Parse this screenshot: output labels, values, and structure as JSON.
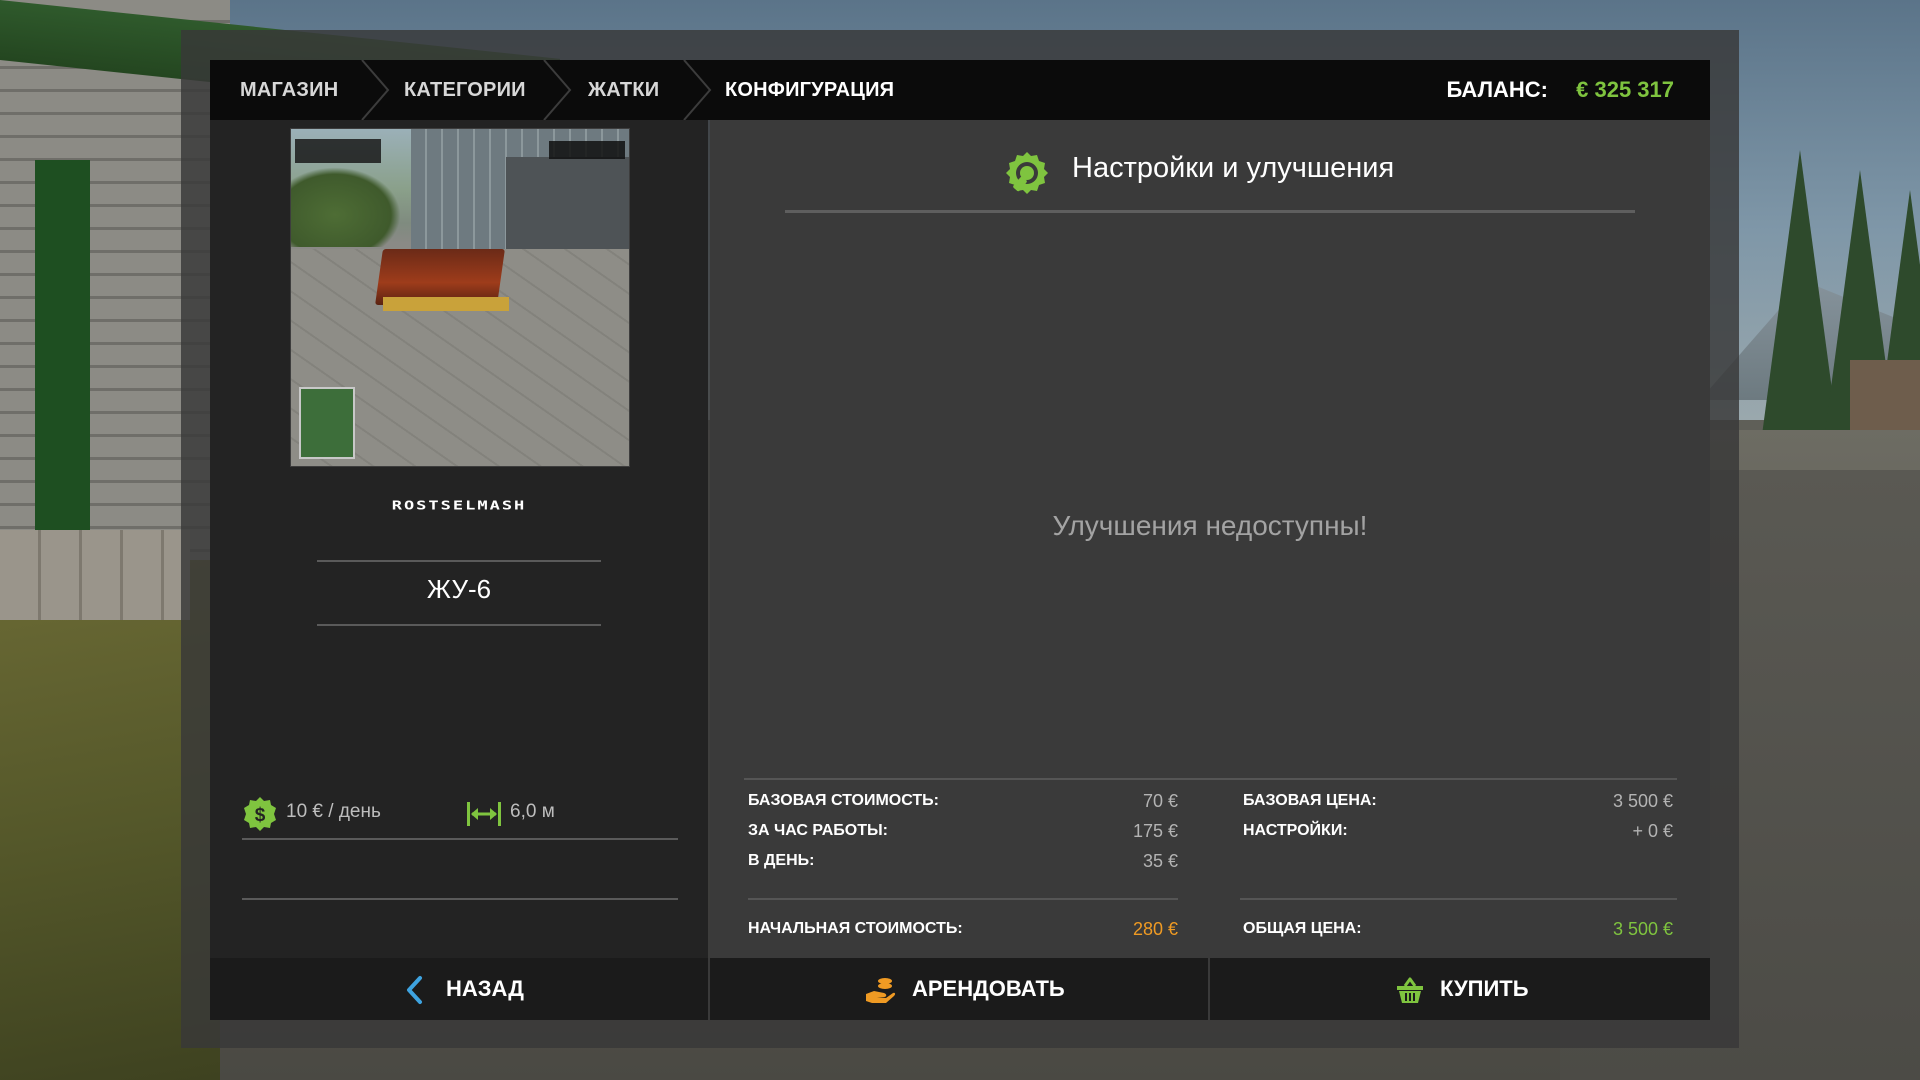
{
  "breadcrumb": {
    "items": [
      "МАГАЗИН",
      "КАТЕГОРИИ",
      "ЖАТКИ",
      "КОНФИГУРАЦИЯ"
    ]
  },
  "balance": {
    "label": "БАЛАНС:",
    "value": "€ 325 317"
  },
  "vehicle": {
    "brand": "ROSTSELMASH",
    "model": "ЖУ-6",
    "stats": {
      "rent_per_day": "10 € / день",
      "width": "6,0 м"
    }
  },
  "config": {
    "title": "Настройки и улучшения",
    "empty_message": "Улучшения недоступны!"
  },
  "costs": {
    "left": [
      {
        "label": "БАЗОВАЯ СТОИМОСТЬ:",
        "value": "70 €"
      },
      {
        "label": "ЗА ЧАС РАБОТЫ:",
        "value": "175 €"
      },
      {
        "label": "В ДЕНЬ:",
        "value": "35 €"
      }
    ],
    "left_total": {
      "label": "НАЧАЛЬНАЯ СТОИМОСТЬ:",
      "value": "280 €"
    },
    "right": [
      {
        "label": "БАЗОВАЯ ЦЕНА:",
        "value": "3 500 €"
      },
      {
        "label": "НАСТРОЙКИ:",
        "value": "+ 0 €"
      }
    ],
    "right_total": {
      "label": "ОБЩАЯ ЦЕНА:",
      "value": "3 500 €"
    }
  },
  "buttons": {
    "back": "НАЗАД",
    "lease": "АРЕНДОВАТЬ",
    "buy": "КУПИТЬ"
  },
  "icons": {
    "gear": "wrench-gear-icon",
    "money": "dollar-coin-icon",
    "width": "width-arrows-icon",
    "back": "chevron-left-icon",
    "lease": "hand-coins-icon",
    "buy": "basket-icon"
  },
  "colors": {
    "accent_green": "#7fc43f",
    "accent_orange": "#ef9a23",
    "back_blue": "#3ea3e0"
  }
}
